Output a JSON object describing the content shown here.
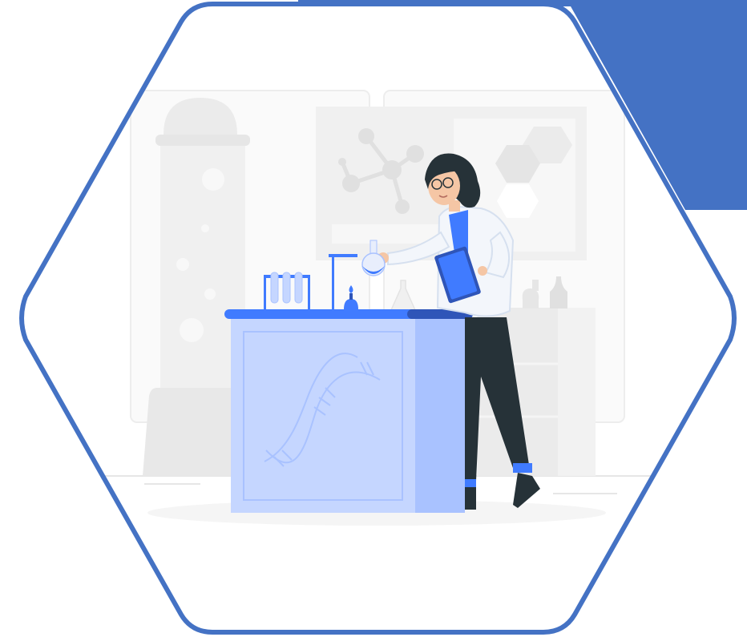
{
  "scene": {
    "subject": "scientist-in-laboratory",
    "frame_shape": "hexagon"
  },
  "colors": {
    "accent_blue": "#4472c4",
    "bright_blue": "#407bff",
    "light_blue": "#c5d6ff",
    "mid_blue": "#a9c2ff",
    "dark_blue": "#2f55b8",
    "background_white": "#ffffff",
    "lab_gray": "#f2f2f2",
    "lab_gray_dark": "#e6e6e6",
    "pants": "#263238",
    "skin": "#f5c6a5"
  },
  "icons": [
    "dna-icon",
    "molecule-icon",
    "flask-icon",
    "test-tube-icon",
    "clipboard-icon",
    "burner-icon"
  ]
}
